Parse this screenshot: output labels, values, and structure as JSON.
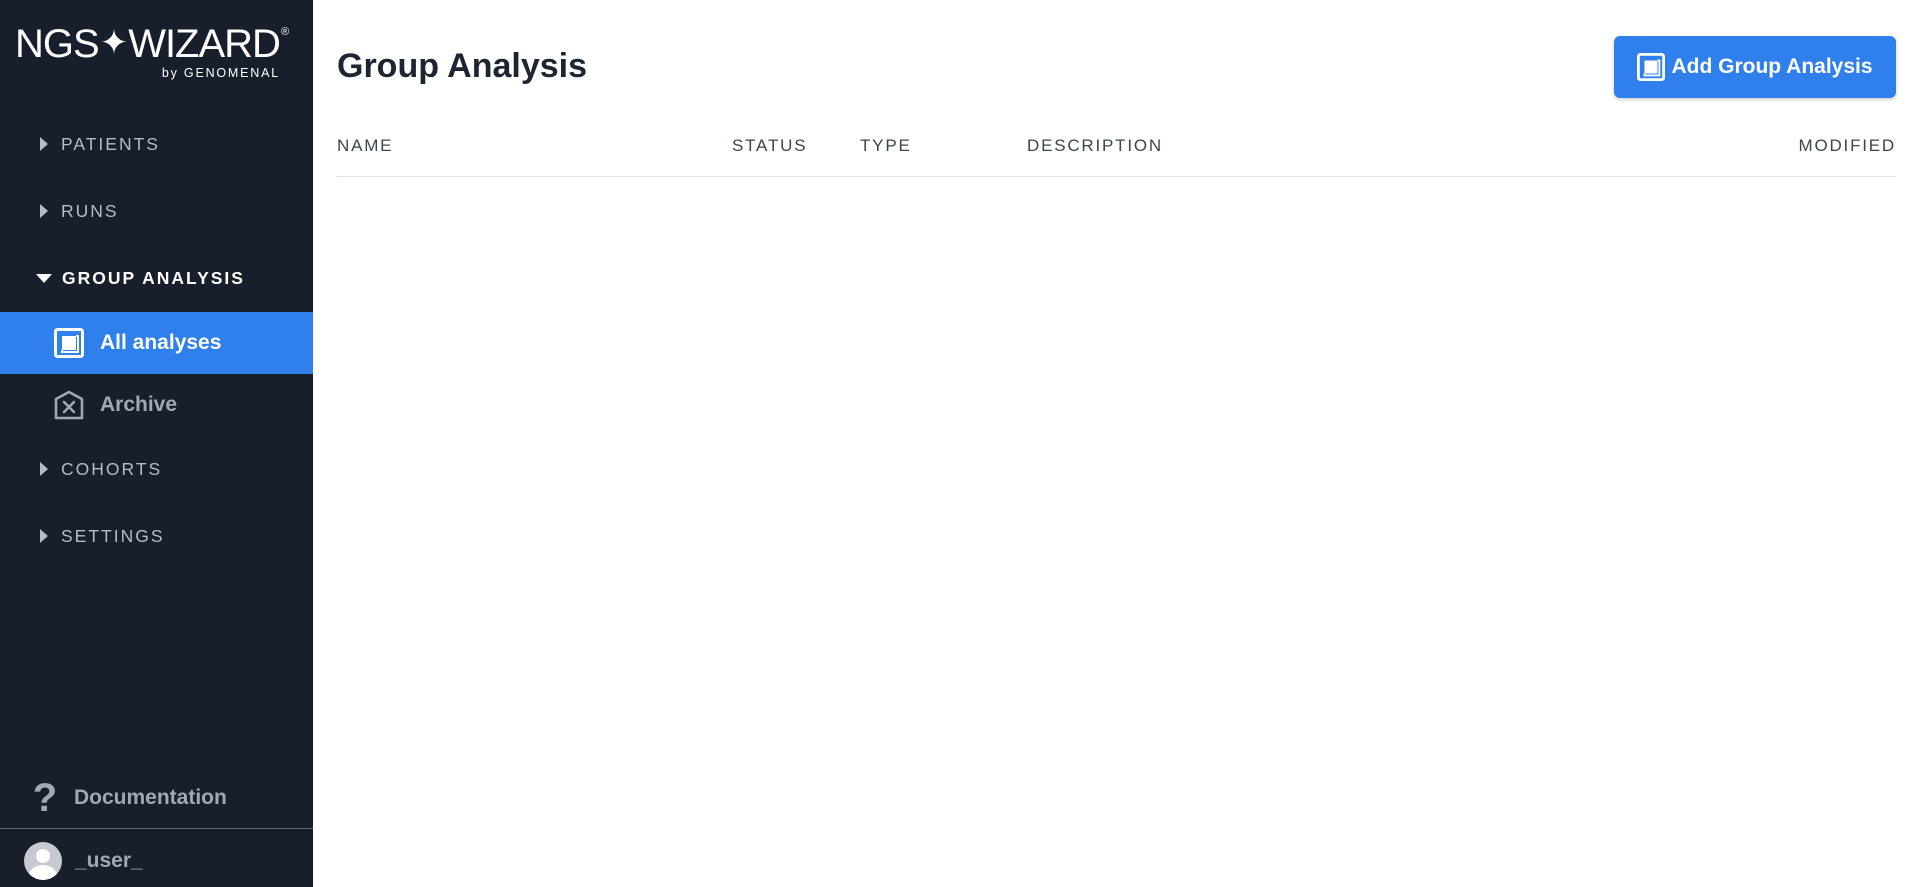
{
  "logo": {
    "brand_left": "NGS",
    "brand_right": "WIZARD",
    "star": "✦",
    "registered": "®",
    "byline": "by GENOMENAL"
  },
  "sidebar": {
    "sections": [
      {
        "label": "PATIENTS",
        "expanded": false
      },
      {
        "label": "RUNS",
        "expanded": false
      },
      {
        "label": "GROUP ANALYSIS",
        "expanded": true
      },
      {
        "label": "COHORTS",
        "expanded": false
      },
      {
        "label": "SETTINGS",
        "expanded": false
      }
    ],
    "group_analysis_items": [
      {
        "label": "All analyses",
        "icon": "all-analyses-icon",
        "active": true
      },
      {
        "label": "Archive",
        "icon": "archive-icon",
        "active": false
      }
    ],
    "documentation": {
      "label": "Documentation",
      "icon": "question-mark-icon"
    },
    "user": {
      "name": "_user_",
      "icon": "user-avatar-icon"
    }
  },
  "main": {
    "title": "Group Analysis",
    "add_button": {
      "label": "Add Group Analysis",
      "icon": "all-analyses-icon"
    },
    "table": {
      "columns": [
        "NAME",
        "STATUS",
        "TYPE",
        "DESCRIPTION",
        "MODIFIED"
      ],
      "rows": []
    }
  },
  "colors": {
    "sidebar_bg": "#161f2b",
    "accent": "#2f80ed",
    "title_text": "#1d2530",
    "muted_text": "#b4bcc8"
  }
}
